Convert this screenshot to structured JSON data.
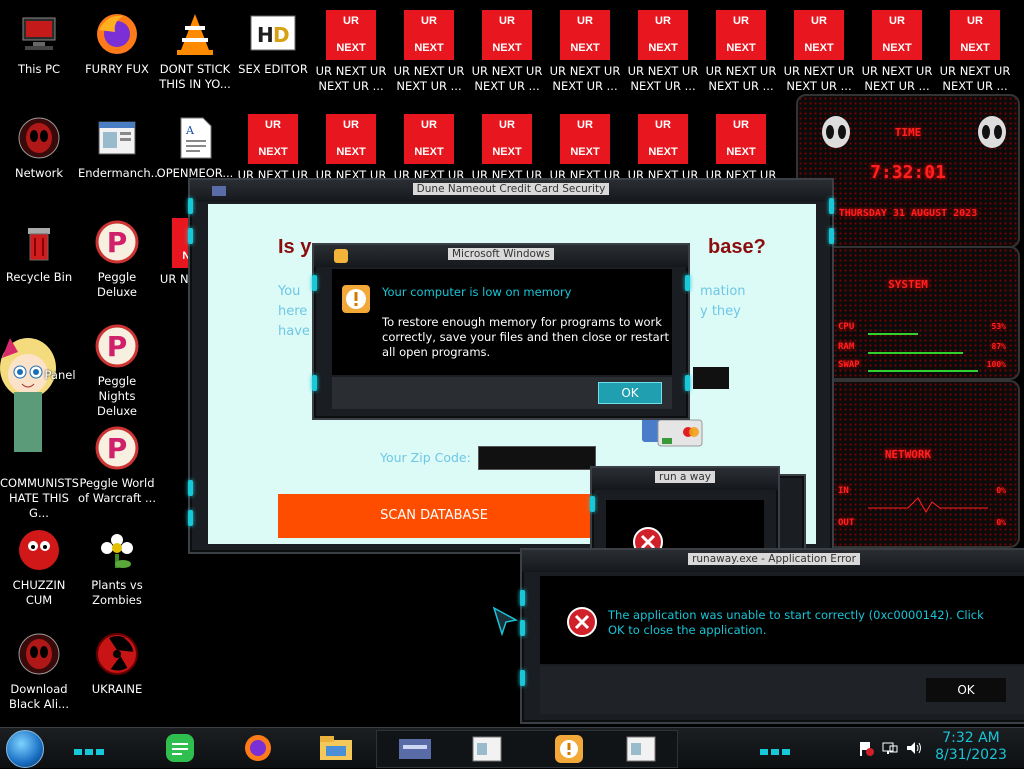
{
  "desktop": {
    "icons_left": [
      {
        "label": "This PC"
      },
      {
        "label": "FURRY FUX"
      },
      {
        "label": "DONT STICK THIS IN YO..."
      },
      {
        "label": "SEX EDITOR"
      },
      {
        "label": "Network"
      },
      {
        "label": "Endermanch..."
      },
      {
        "label": "OPENMEOR..."
      },
      {
        "label": "Recycle Bin"
      },
      {
        "label": "Peggle Deluxe"
      },
      {
        "label": "UR NE NEXT"
      },
      {
        "label": "Panel"
      },
      {
        "label": "Peggle Nights Deluxe"
      },
      {
        "label": "COMMUNISTS HATE THIS G..."
      },
      {
        "label": "Peggle World of Warcraft ..."
      },
      {
        "label": "CHUZZIN CUM"
      },
      {
        "label": "Plants vs Zombies"
      },
      {
        "label": "Download Black Ali..."
      },
      {
        "label": "UKRAINE"
      }
    ],
    "ur_icon_text": {
      "top": "UR",
      "bottom": "NEXT"
    },
    "ur_row1_label": "UR NEXT UR NEXT UR ...",
    "ur_row2_label": "UR NEXT UR"
  },
  "scam_window": {
    "title": "Dune Nameout Credit Card Security",
    "heading_left": "Is y",
    "heading_right": "base?",
    "para_left_1": "You",
    "para_left_2": "here",
    "para_left_3": "have",
    "para_right_1": "mation",
    "para_right_2": "y they",
    "zip_label": "Your Zip Code:",
    "scan_button": "SCAN DATABASE"
  },
  "memory_dialog": {
    "title": "Microsoft Windows",
    "heading": "Your computer is low on memory",
    "body": "To restore enough memory for programs to work correctly, save your files and then close or restart all open programs.",
    "ok": "OK"
  },
  "small_window": {
    "title": "run a way"
  },
  "error_dialog": {
    "title": "runaway.exe - Application Error",
    "message": "The application was unable to start correctly (0xc0000142). Click OK to close the application.",
    "ok": "OK"
  },
  "gadget": {
    "time_title": "TIME",
    "time": "7:32:01",
    "date": "THURSDAY 31 AUGUST 2023",
    "system_title": "SYSTEM",
    "rows": [
      {
        "label": "CPU",
        "value": "53%"
      },
      {
        "label": "RAM",
        "value": "87%"
      },
      {
        "label": "SWAP",
        "value": "100%"
      }
    ],
    "network_title": "NETWORK",
    "net_rows": [
      {
        "label": "IN",
        "value": "0%"
      },
      {
        "label": "OUT",
        "value": "0%"
      }
    ]
  },
  "taskbar": {
    "clock_time": "7:32 AM",
    "clock_date": "8/31/2023"
  },
  "colors": {
    "accent_cyan": "#18c8d8",
    "ur_red": "#e8171f",
    "scan_orange": "#ff4d00",
    "heading_darkred": "#8b0d0d",
    "error_red": "#d0202a"
  }
}
